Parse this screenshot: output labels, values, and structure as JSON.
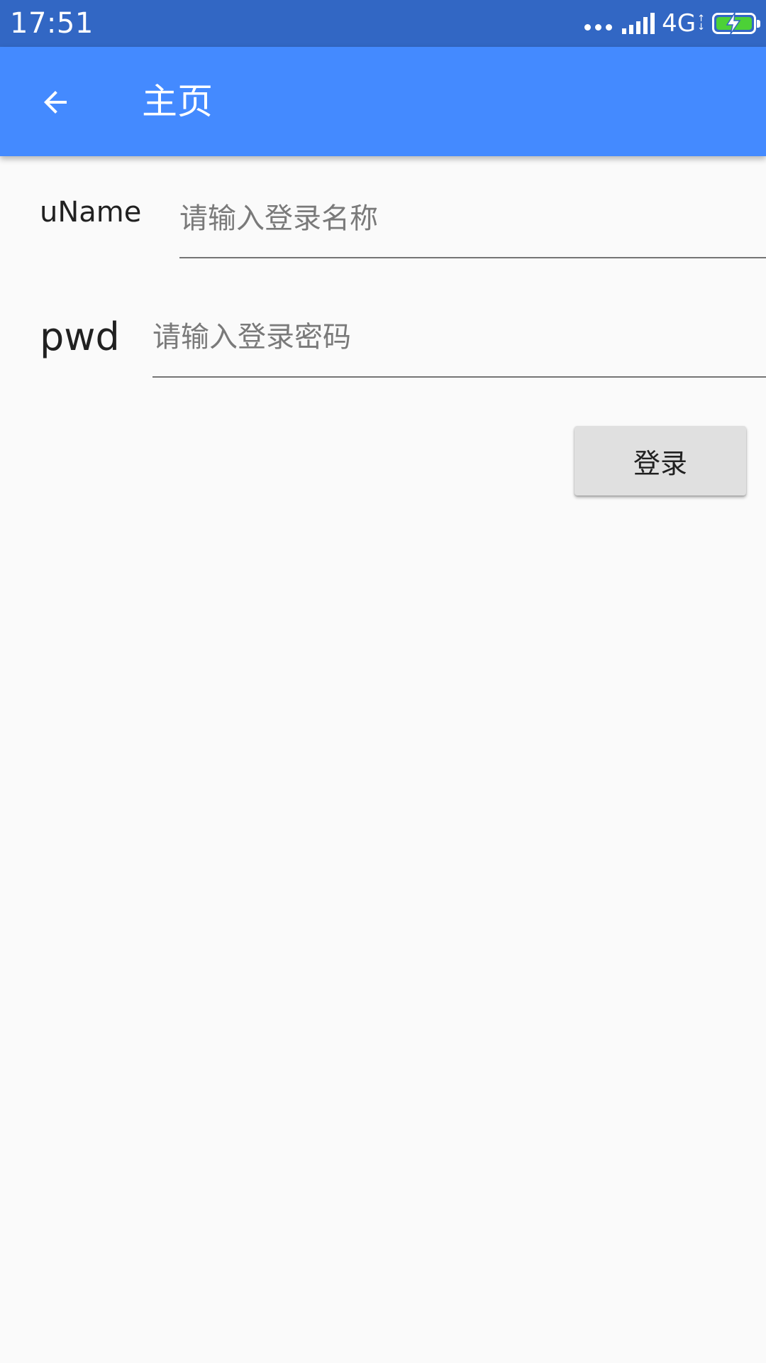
{
  "status_bar": {
    "time": "17:51",
    "network": "4G",
    "signal_icon": "signal-bars-icon",
    "battery_icon": "battery-charging-icon",
    "battery_color": "#4cd137"
  },
  "app_bar": {
    "title": "主页",
    "back_icon": "arrow-back-icon",
    "background": "#448aff"
  },
  "form": {
    "uname": {
      "label": "uName",
      "value": "",
      "placeholder": "请输入登录名称"
    },
    "pwd": {
      "label": "pwd",
      "value": "",
      "placeholder": "请输入登录密码"
    },
    "login_button_label": "登录"
  }
}
